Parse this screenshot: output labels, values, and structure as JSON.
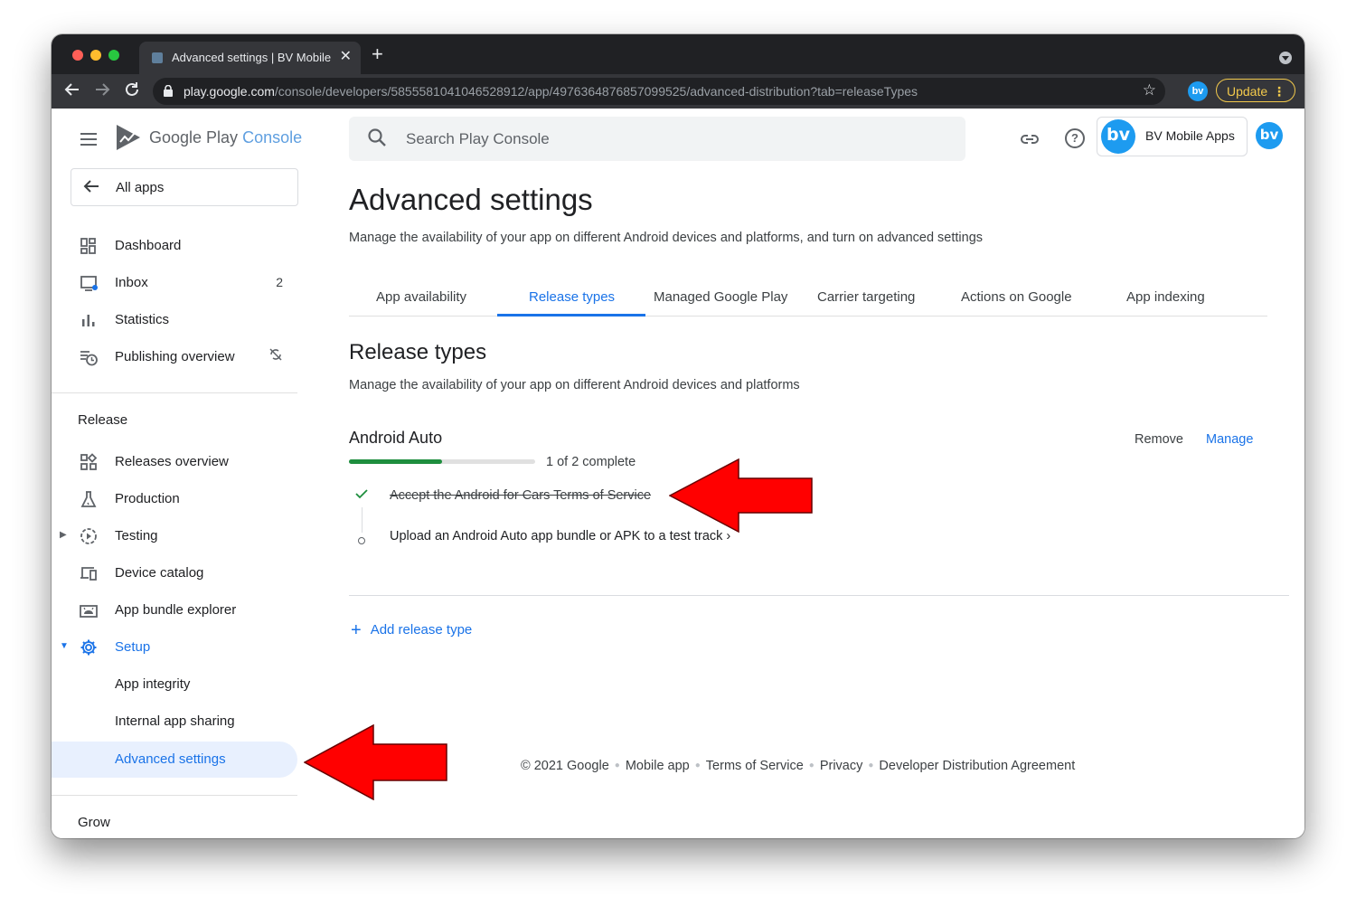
{
  "browser": {
    "tab_title": "Advanced settings | BV Mobile",
    "tab_close": "✕",
    "new_tab": "+",
    "url_host": "play.google.com",
    "url_path": "/console/developers/5855581041046528912/app/4976364876857099525/advanced-distribution?tab=releaseTypes",
    "profile_initials": "bv",
    "update_label": "Update"
  },
  "sidebar": {
    "logo_google_play": "Google Play",
    "logo_console": "Console",
    "all_apps": "All apps",
    "items": [
      {
        "label": "Dashboard"
      },
      {
        "label": "Inbox",
        "badge": "2"
      },
      {
        "label": "Statistics"
      },
      {
        "label": "Publishing overview"
      }
    ],
    "release_heading": "Release",
    "release_items": [
      {
        "label": "Releases overview"
      },
      {
        "label": "Production"
      },
      {
        "label": "Testing"
      },
      {
        "label": "Device catalog"
      },
      {
        "label": "App bundle explorer"
      },
      {
        "label": "Setup"
      },
      {
        "label": "App integrity"
      },
      {
        "label": "Internal app sharing"
      },
      {
        "label": "Advanced settings"
      }
    ],
    "grow_heading": "Grow"
  },
  "topbar": {
    "search_placeholder": "Search Play Console",
    "account_name": "BV Mobile Apps",
    "account_logo": "bv",
    "help_glyph": "?"
  },
  "main": {
    "title": "Advanced settings",
    "subtitle": "Manage the availability of your app on different Android devices and platforms, and turn on advanced settings",
    "tabs": [
      {
        "label": "App availability"
      },
      {
        "label": "Release types"
      },
      {
        "label": "Managed Google Play"
      },
      {
        "label": "Carrier targeting"
      },
      {
        "label": "Actions on Google"
      },
      {
        "label": "App indexing"
      }
    ],
    "section_title": "Release types",
    "section_subtitle": "Manage the availability of your app on different Android devices and platforms",
    "card": {
      "title": "Android Auto",
      "remove": "Remove",
      "manage": "Manage",
      "progress_fraction": 0.5,
      "progress_text": "1 of 2 complete",
      "steps": [
        {
          "text": "Accept the Android for Cars Terms of Service",
          "done": true
        },
        {
          "text": "Upload an Android Auto app bundle or APK to a test track ›",
          "done": false
        }
      ]
    },
    "add_release_type": "Add release type"
  },
  "footer": {
    "copyright": "© 2021 Google",
    "links": [
      "Mobile app",
      "Terms of Service",
      "Privacy",
      "Developer Distribution Agreement"
    ]
  },
  "colors": {
    "accent": "#1a73e8",
    "progress": "#1e8e3e",
    "annotation_arrow": "#ff0000"
  }
}
